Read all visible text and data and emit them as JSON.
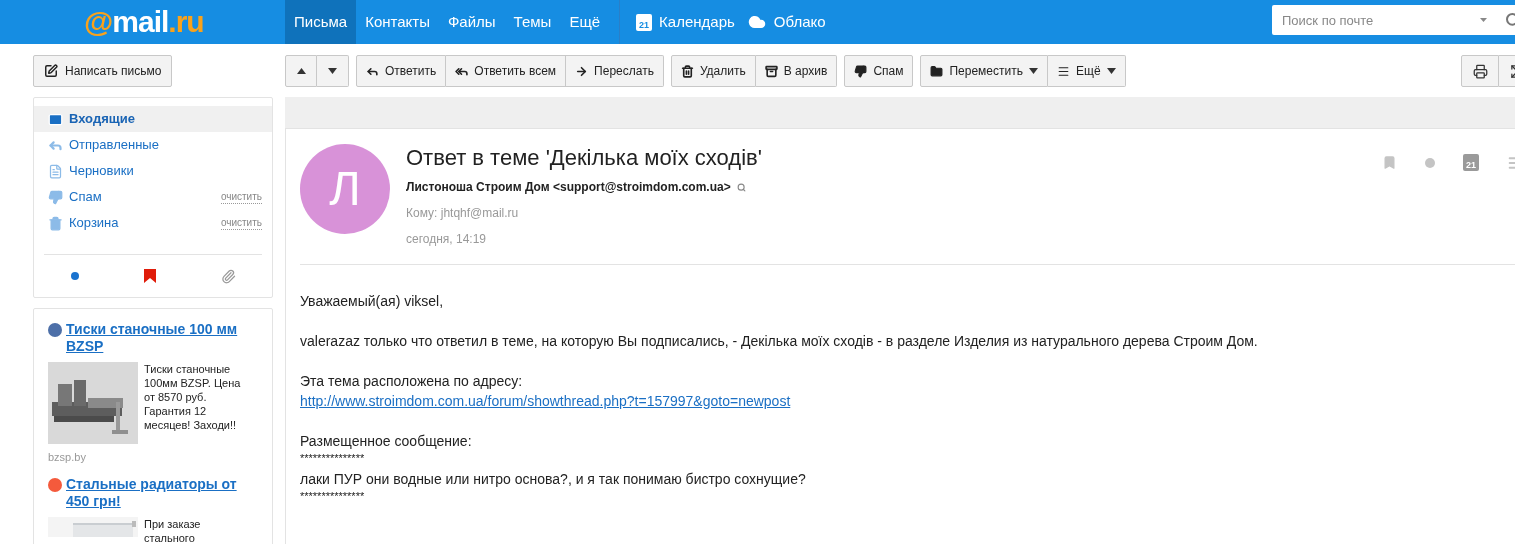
{
  "header": {
    "logo": "@mail.ru",
    "nav": [
      {
        "label": "Письма",
        "selected": true
      },
      {
        "label": "Контакты",
        "selected": false
      },
      {
        "label": "Файлы",
        "selected": false
      },
      {
        "label": "Темы",
        "selected": false
      },
      {
        "label": "Ещё",
        "selected": false
      }
    ],
    "apps": [
      {
        "kind": "calendar",
        "label": "Календарь",
        "badge": "21"
      },
      {
        "kind": "cloud",
        "label": "Облако"
      }
    ],
    "search": {
      "placeholder": "Поиск по почте"
    }
  },
  "toolbar": {
    "compose": "Написать письмо",
    "groups": [
      {
        "buttons": [
          {
            "kind": "up"
          },
          {
            "kind": "down"
          }
        ]
      },
      {
        "buttons": [
          {
            "kind": "reply",
            "label": "Ответить"
          },
          {
            "kind": "reply_all",
            "label": "Ответить всем"
          },
          {
            "kind": "forward",
            "label": "Переслать"
          }
        ]
      },
      {
        "buttons": [
          {
            "kind": "delete",
            "label": "Удалить"
          },
          {
            "kind": "archive",
            "label": "В архив"
          }
        ]
      },
      {
        "buttons": [
          {
            "kind": "spam",
            "label": "Спам"
          }
        ]
      },
      {
        "buttons": [
          {
            "kind": "move",
            "label": "Переместить"
          },
          {
            "kind": "more",
            "label": "Ещё"
          }
        ]
      }
    ],
    "right": [
      {
        "kind": "print"
      },
      {
        "kind": "expand"
      }
    ]
  },
  "folders": [
    {
      "kind": "inbox",
      "label": "Входящие",
      "selected": true
    },
    {
      "kind": "sent",
      "label": "Отправленные",
      "selected": false
    },
    {
      "kind": "drafts",
      "label": "Черновики",
      "selected": false
    },
    {
      "kind": "spam",
      "label": "Спам",
      "action": "очистить",
      "selected": false
    },
    {
      "kind": "trash",
      "label": "Корзина",
      "action": "очистить",
      "selected": false
    }
  ],
  "filters": [
    {
      "kind": "unread"
    },
    {
      "kind": "flagged"
    },
    {
      "kind": "attachments"
    }
  ],
  "ads": [
    {
      "color": "#4d6fa8",
      "title": "Тиски станочные 100 мм BZSP",
      "text": "Тиски станочные 100мм BZSP. Цена от 8570 руб. Гарантия 12 месяцев! Заходи!!",
      "domain": "bzsp.by"
    },
    {
      "color": "#f45a3c",
      "title": "Стальные радиаторы от 450 грн!",
      "text": "При заказе стального"
    }
  ],
  "message": {
    "subject": "Ответ в теме 'Декілька моїх сходів'",
    "avatar": "Л",
    "sender": "Листоноша Строим Дом <support@stroimdom.com.ua>",
    "to": "Кому: jhtqhf@mail.ru",
    "date": "сегодня, 14:19",
    "actions": [
      {
        "kind": "flag"
      },
      {
        "kind": "unread"
      },
      {
        "kind": "calendar",
        "badge": "21"
      },
      {
        "kind": "more"
      }
    ],
    "body": [
      [
        {
          "kind": "text",
          "text": "Уважаемый(ая) viksel,"
        }
      ],
      [
        {
          "kind": "text",
          "text": "valerazaz только что ответил в теме, на которую Вы подписались, - Декілька моїх сходів - в разделе Изделия из натурального дерева Строим Дом."
        }
      ],
      [
        {
          "kind": "text",
          "text": "Эта тема расположена по адресу:"
        },
        {
          "kind": "link",
          "text": "http://www.stroimdom.com.ua/forum/showthread.php?t=157997&goto=newpost"
        }
      ],
      [
        {
          "kind": "text",
          "text": "Размещенное сообщение:"
        },
        {
          "kind": "text",
          "text": "***************"
        },
        {
          "kind": "text",
          "text": "лаки ПУР они водные или нитро основа?, и я так понимаю бистро сохнущие?"
        },
        {
          "kind": "text",
          "text": "***************"
        }
      ]
    ]
  }
}
